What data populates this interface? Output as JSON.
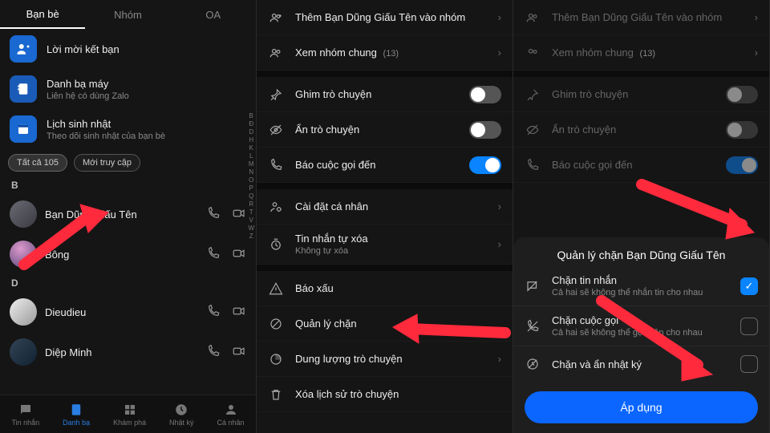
{
  "panel1": {
    "tabs": [
      "Bạn bè",
      "Nhóm",
      "OA"
    ],
    "active_tab": 0,
    "quick": [
      {
        "title": "Lời mời kết bạn",
        "sub": ""
      },
      {
        "title": "Danh bạ máy",
        "sub": "Liên hệ có dùng Zalo"
      },
      {
        "title": "Lịch sinh nhật",
        "sub": "Theo dõi sinh nhật của bạn bè"
      }
    ],
    "chips": {
      "all": "Tất cả",
      "all_count": "105",
      "recent": "Mới truy cập"
    },
    "index": [
      "B",
      "Đ",
      "D",
      "H",
      "K",
      "L",
      "M",
      "N",
      "O",
      "P",
      "Q",
      "R",
      "T",
      "V",
      "W",
      "Z"
    ],
    "sections": [
      {
        "letter": "B",
        "contacts": [
          "Bạn Dũng Giấu Tên",
          "Bông"
        ]
      },
      {
        "letter": "D",
        "contacts": [
          "Dieudieu",
          "Diệp Minh"
        ]
      }
    ],
    "nav": [
      "Tin nhắn",
      "Danh bạ",
      "Khám phá",
      "Nhật ký",
      "Cá nhân"
    ],
    "nav_active": 1
  },
  "panel2": {
    "rows_top": [
      {
        "label": "Thêm Bạn Dũng Giấu Tên vào nhóm",
        "type": "chev"
      },
      {
        "label": "Xem nhóm chung",
        "count": "(13)",
        "type": "chev"
      }
    ],
    "rows_toggle": [
      {
        "label": "Ghim trò chuyện",
        "on": false
      },
      {
        "label": "Ẩn trò chuyện",
        "on": false
      },
      {
        "label": "Báo cuộc gọi đến",
        "on": true
      }
    ],
    "rows_mid": [
      {
        "label": "Cài đặt cá nhân",
        "type": "chev"
      },
      {
        "label": "Tin nhắn tự xóa",
        "sub": "Không tự xóa",
        "type": "chev"
      }
    ],
    "rows_bot": [
      {
        "label": "Báo xấu"
      },
      {
        "label": "Quản lý chặn"
      },
      {
        "label": "Dung lượng trò chuyện",
        "type": "chev"
      },
      {
        "label": "Xóa lịch sử trò chuyện"
      }
    ]
  },
  "panel3": {
    "rows_top": [
      {
        "label": "Thêm Bạn Dũng Giấu Tên vào nhóm",
        "type": "chev"
      },
      {
        "label": "Xem nhóm chung",
        "count": "(13)",
        "type": "chev"
      }
    ],
    "rows_toggle": [
      {
        "label": "Ghim trò chuyện",
        "on": false
      },
      {
        "label": "Ẩn trò chuyện",
        "on": false
      },
      {
        "label": "Báo cuộc gọi đến",
        "on": true
      }
    ],
    "sheet": {
      "title": "Quản lý chặn Bạn Dũng Giấu Tên",
      "opts": [
        {
          "label": "Chặn tin nhắn",
          "sub": "Cả hai sẽ không thể nhắn tin cho nhau",
          "on": true
        },
        {
          "label": "Chặn cuộc gọi",
          "sub": "Cả hai sẽ không thể gọi điện cho nhau",
          "on": false
        },
        {
          "label": "Chặn và ẩn nhật ký",
          "sub": "",
          "on": false
        }
      ],
      "apply": "Áp dụng"
    }
  }
}
